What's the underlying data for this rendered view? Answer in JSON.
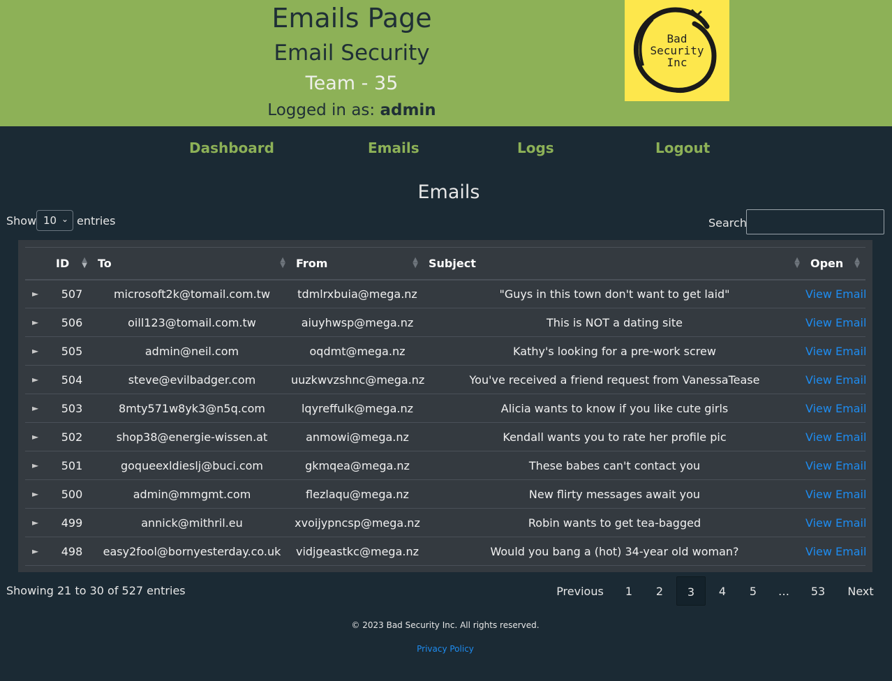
{
  "header": {
    "title": "Emails Page",
    "subtitle": "Email Security",
    "team": "Team - 35",
    "logged_in_label": "Logged in as:",
    "username": "admin",
    "logo_lines": [
      "Bad",
      "Security",
      "Inc"
    ],
    "background_color": "#8db157",
    "logo_background_color": "#fde74c"
  },
  "nav": {
    "items": [
      {
        "label": "Dashboard"
      },
      {
        "label": "Emails"
      },
      {
        "label": "Logs"
      },
      {
        "label": "Logout"
      }
    ],
    "link_color": "#8db157"
  },
  "emails_section": {
    "title": "Emails",
    "length_menu": {
      "prefix": "Show",
      "selected": "10",
      "suffix": "entries"
    },
    "search": {
      "label": "Search:",
      "value": ""
    },
    "columns": [
      "ID",
      "To",
      "From",
      "Subject",
      "Open"
    ],
    "sort": {
      "column": "ID",
      "direction": "desc"
    },
    "rows": [
      {
        "id": "507",
        "to": "microsoft2k@tomail.com.tw",
        "from": "tdmlrxbuia@mega.nz",
        "subject": "\"Guys in this town don't want to get laid\"",
        "open": "View Email"
      },
      {
        "id": "506",
        "to": "oill123@tomail.com.tw",
        "from": "aiuyhwsp@mega.nz",
        "subject": "This is NOT a dating site",
        "open": "View Email"
      },
      {
        "id": "505",
        "to": "admin@neil.com",
        "from": "oqdmt@mega.nz",
        "subject": "Kathy's looking for a pre-work screw",
        "open": "View Email"
      },
      {
        "id": "504",
        "to": "steve@evilbadger.com",
        "from": "uuzkwvzshnc@mega.nz",
        "subject": "You've received a friend request from VanessaTease",
        "open": "View Email"
      },
      {
        "id": "503",
        "to": "8mty571w8yk3@n5q.com",
        "from": "lqyreffulk@mega.nz",
        "subject": "Alicia wants to know if you like cute girls",
        "open": "View Email"
      },
      {
        "id": "502",
        "to": "shop38@energie-wissen.at",
        "from": "anmowi@mega.nz",
        "subject": "Kendall wants you to rate her profile pic",
        "open": "View Email"
      },
      {
        "id": "501",
        "to": "goqueexldieslj@buci.com",
        "from": "gkmqea@mega.nz",
        "subject": "These babes can't contact you",
        "open": "View Email"
      },
      {
        "id": "500",
        "to": "admin@mmgmt.com",
        "from": "flezlaqu@mega.nz",
        "subject": "New flirty messages await you",
        "open": "View Email"
      },
      {
        "id": "499",
        "to": "annick@mithril.eu",
        "from": "xvoijypncsp@mega.nz",
        "subject": "Robin wants to get tea-bagged",
        "open": "View Email"
      },
      {
        "id": "498",
        "to": "easy2fool@bornyesterday.co.uk",
        "from": "vidjgeastkc@mega.nz",
        "subject": "Would you bang a (hot) 34-year old woman?",
        "open": "View Email"
      }
    ],
    "info": "Showing 21 to 30 of 527 entries",
    "pagination": {
      "previous": "Previous",
      "pages": [
        "1",
        "2",
        "3",
        "4",
        "5",
        "…",
        "53"
      ],
      "current": "3",
      "next": "Next"
    }
  },
  "footer": {
    "copyright": "© 2023 Bad Security Inc. All rights reserved.",
    "privacy": "Privacy Policy"
  }
}
